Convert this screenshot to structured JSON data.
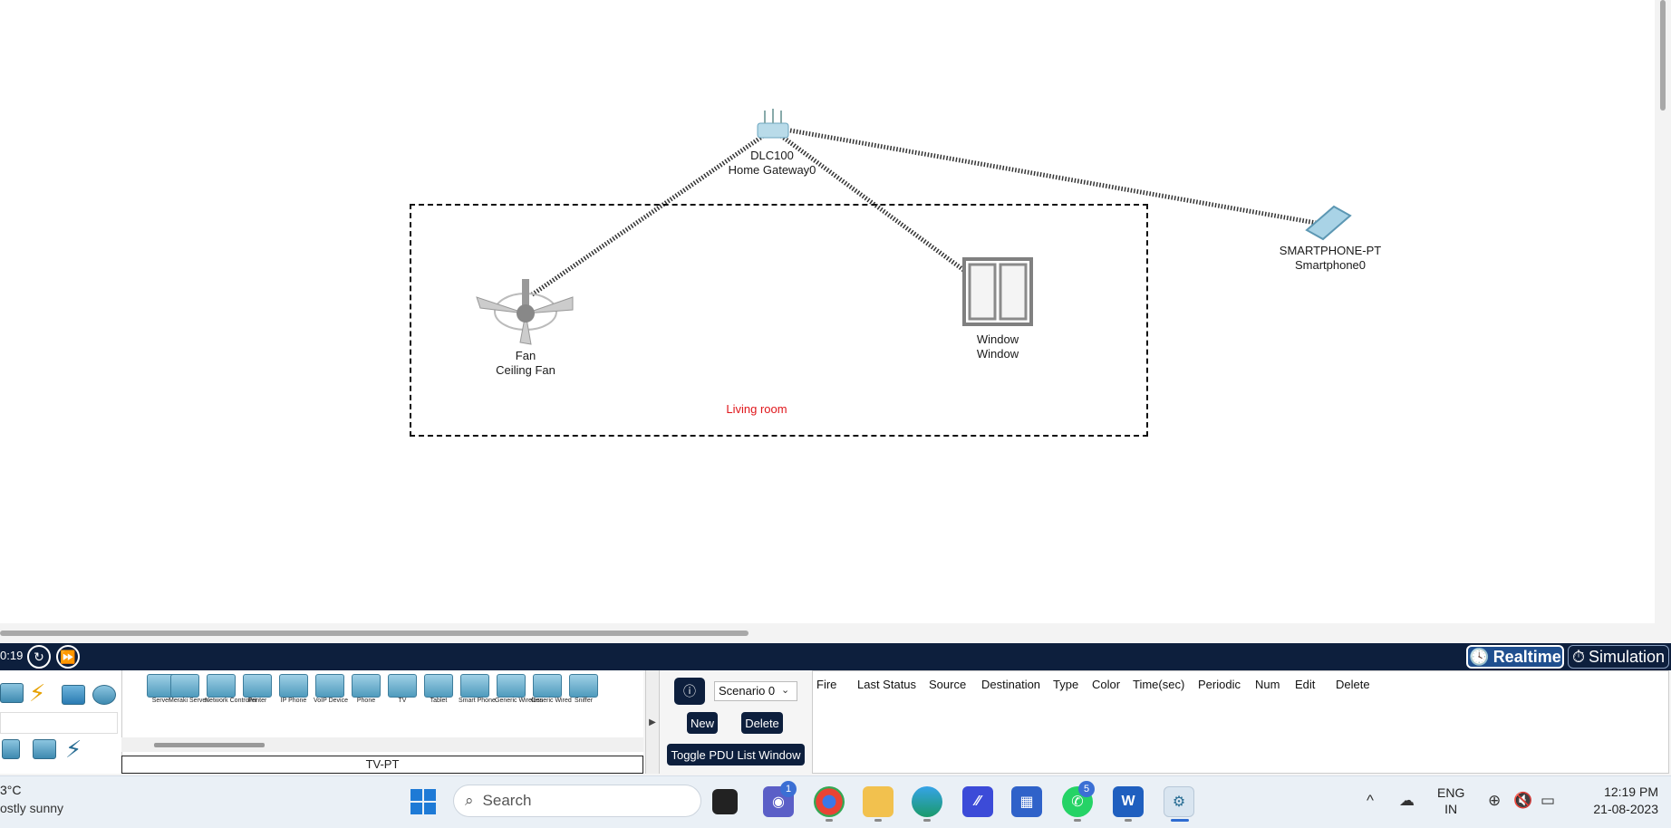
{
  "workspace": {
    "devices": [
      {
        "model": "DLC100",
        "name": "Home Gateway0"
      },
      {
        "model": "Fan",
        "name": "Ceiling Fan"
      },
      {
        "model": "Window",
        "name": "Window"
      },
      {
        "model": "SMARTPHONE-PT",
        "name": "Smartphone0"
      }
    ],
    "cluster_label": "Living room"
  },
  "realtime_bar": {
    "time": "0:19",
    "reset_icon": "power-cycle-icon",
    "fast_forward_icon": "fast-forward-icon",
    "realtime_label": "Realtime",
    "simulation_label": "Simulation"
  },
  "device_panel": {
    "tiles": [
      "Server",
      "Meraki Server",
      "Network Controller",
      "Printer",
      "IP Phone",
      "VoIP Device",
      "Phone",
      "TV",
      "Tablet",
      "Smart Phone",
      "Generic Wireless",
      "Generic Wired",
      "Sniffer"
    ],
    "selected_device": "TV-PT"
  },
  "scenario_panel": {
    "scenario": "Scenario 0",
    "new_label": "New",
    "delete_label": "Delete",
    "toggle_label": "Toggle PDU List Window"
  },
  "pdu_table": {
    "headers": [
      "Fire",
      "Last Status",
      "Source",
      "Destination",
      "Type",
      "Color",
      "Time(sec)",
      "Periodic",
      "Num",
      "Edit",
      "Delete"
    ]
  },
  "taskbar": {
    "weather_temp": "3°C",
    "weather_desc": "ostly sunny",
    "search_placeholder": "Search",
    "teams_badge": "1",
    "whatsapp_badge": "5",
    "lang_top": "ENG",
    "lang_bottom": "IN",
    "time": "12:19 PM",
    "date": "21-08-2023"
  }
}
